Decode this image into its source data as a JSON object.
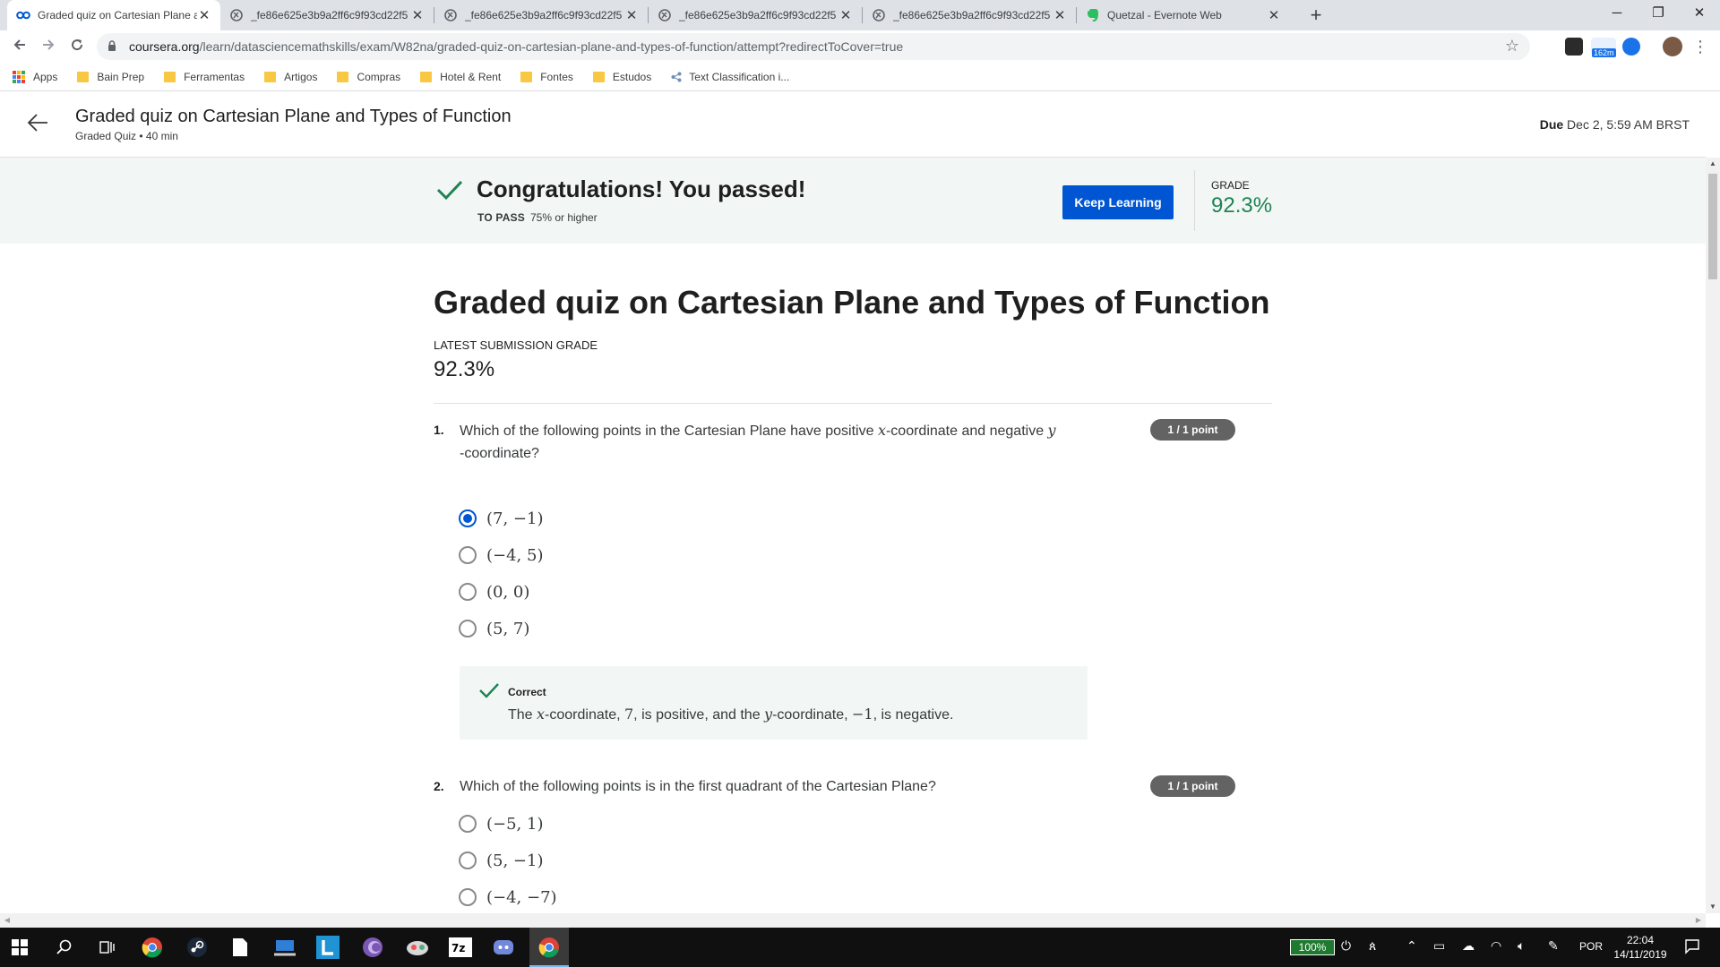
{
  "browser": {
    "tabs": [
      {
        "title": "Graded quiz on Cartesian Plane a",
        "active": true
      },
      {
        "title": "_fe86e625e3b9a2ff6c9f93cd22f5",
        "active": false
      },
      {
        "title": "_fe86e625e3b9a2ff6c9f93cd22f5",
        "active": false
      },
      {
        "title": "_fe86e625e3b9a2ff6c9f93cd22f5",
        "active": false
      },
      {
        "title": "_fe86e625e3b9a2ff6c9f93cd22f5",
        "active": false
      },
      {
        "title": "Quetzal - Evernote Web",
        "active": false
      }
    ],
    "url_domain": "coursera.org",
    "url_path": "/learn/datasciencemathskills/exam/W82na/graded-quiz-on-cartesian-plane-and-types-of-function/attempt?redirectToCover=true",
    "extension_badge": "162m",
    "bookmarks": [
      "Apps",
      "Bain Prep",
      "Ferramentas",
      "Artigos",
      "Compras",
      "Hotel & Rent",
      "Fontes",
      "Estudos",
      "Text Classification i..."
    ]
  },
  "header": {
    "title": "Graded quiz on Cartesian Plane and Types of Function",
    "subtitle": "Graded Quiz • 40 min",
    "due_label": "Due",
    "due_value": "Dec 2, 5:59 AM BRST"
  },
  "banner": {
    "message": "Congratulations! You passed!",
    "to_pass_label": "TO PASS",
    "to_pass_value": "75% or higher",
    "button": "Keep Learning",
    "grade_label": "GRADE",
    "grade_value": "92.3%"
  },
  "main": {
    "title": "Graded quiz on Cartesian Plane and Types of Function",
    "latest_label": "LATEST SUBMISSION GRADE",
    "latest_value": "92.3%"
  },
  "questions": [
    {
      "number": "1.",
      "text_a": "Which of the following points in the Cartesian Plane have positive ",
      "var_x": "x",
      "text_b": "-coordinate and negative ",
      "var_y": "y",
      "text_c": "-coordinate?",
      "points": "1 / 1 point",
      "options": [
        "(7, −1)",
        "(−4, 5)",
        "(0, 0)",
        "(5, 7)"
      ],
      "selected_index": 0,
      "feedback": {
        "label": "Correct",
        "t1": "The ",
        "v1": "x",
        "t2": "-coordinate, ",
        "n1": "7",
        "t3": ", is positive, and the ",
        "v2": "y",
        "t4": "-coordinate, ",
        "n2": "−1",
        "t5": ", is negative."
      }
    },
    {
      "number": "2.",
      "text": "Which of the following points is in the first quadrant of the Cartesian Plane?",
      "points": "1 / 1 point",
      "options": [
        "(−5, 1)",
        "(5, −1)",
        "(−4, −7)"
      ]
    }
  ],
  "taskbar": {
    "battery": "100%",
    "language": "POR",
    "time": "22:04",
    "date": "14/11/2019"
  },
  "colors": {
    "accent": "#0056d2",
    "success": "#1f8354",
    "banner_bg": "#f2f7f5",
    "points_badge": "#636363"
  }
}
